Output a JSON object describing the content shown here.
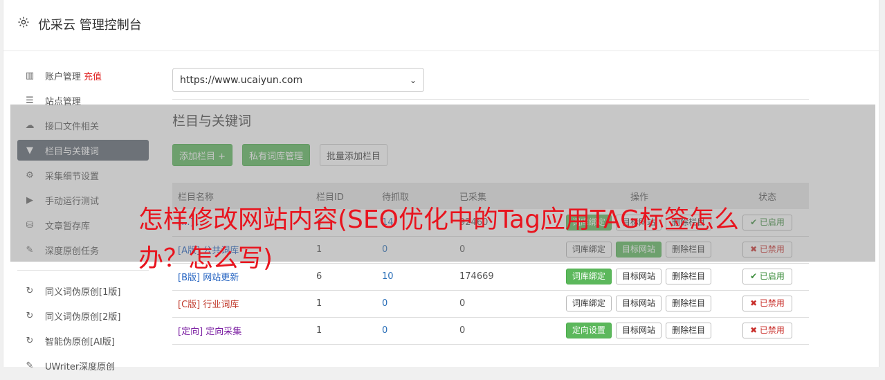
{
  "header": {
    "title": "优采云 管理控制台",
    "icon": "gear-icon"
  },
  "sidebar": {
    "items": [
      {
        "label": "账户管理",
        "extra": "充值",
        "icon": "bar-chart-icon"
      },
      {
        "label": "站点管理",
        "icon": "server-icon"
      },
      {
        "label": "接口文件相关",
        "icon": "cloud-upload-icon"
      },
      {
        "label": "栏目与关键词",
        "icon": "filter-icon",
        "active": true
      },
      {
        "label": "采集细节设置",
        "icon": "cogs-icon"
      },
      {
        "label": "手动运行测试",
        "icon": "play-circle-icon"
      },
      {
        "label": "文章暂存库",
        "icon": "database-icon"
      },
      {
        "label": "深度原创任务",
        "icon": "edit-icon"
      }
    ],
    "items2": [
      {
        "label": "同义词伪原创[1版]",
        "icon": "refresh-icon"
      },
      {
        "label": "同义词伪原创[2版]",
        "icon": "refresh-icon"
      },
      {
        "label": "智能伪原创[AI版]",
        "icon": "refresh-icon"
      },
      {
        "label": "UWriter深度原创",
        "icon": "edit-icon"
      }
    ]
  },
  "site_select": {
    "value": "https://www.ucaiyun.com"
  },
  "section": {
    "title": "栏目与关键词"
  },
  "toolbar": {
    "add_label": "添加栏目 +",
    "private_label": "私有词库管理",
    "batch_label": "批量添加栏目"
  },
  "table": {
    "headers": [
      "栏目名称",
      "栏目ID",
      "待抓取",
      "已采集",
      "操作",
      "状态"
    ],
    "rows": [
      {
        "tag": "[...]",
        "name": "...",
        "id": "4",
        "pending": "14",
        "collected": "92460",
        "bind": "词库绑定",
        "target": "目标网站",
        "del": "删除栏目",
        "status": "✔ 已启用"
      },
      {
        "tag": "[A版]",
        "name": "公共词库",
        "id": "1",
        "pending": "0",
        "collected": "0",
        "bind": "词库绑定",
        "target": "目标网站",
        "del": "删除栏目",
        "status": "✖ 已禁用"
      },
      {
        "tag": "[B版]",
        "name": "网站更新",
        "id": "6",
        "pending": "10",
        "collected": "174669",
        "bind": "词库绑定",
        "target": "目标网站",
        "del": "删除栏目",
        "status": "✔ 已启用"
      },
      {
        "tag": "[C版]",
        "name": "行业词库",
        "id": "1",
        "pending": "0",
        "collected": "0",
        "bind": "词库绑定",
        "target": "目标网站",
        "del": "删除栏目",
        "status": "✖ 已禁用"
      },
      {
        "tag": "[定向]",
        "name": "定向采集",
        "id": "1",
        "pending": "0",
        "collected": "0",
        "bind": "定向设置",
        "target": "目标网站",
        "del": "删除栏目",
        "status": "✖ 已禁用"
      }
    ]
  },
  "overlay_headline": "怎样修改网站内容(SEO优化中的Tag应用TAG标签怎么办？怎么写)",
  "colors": {
    "accent_green": "#5cb85c",
    "active_nav": "#5b6470",
    "headline_red": "#e8141e"
  }
}
